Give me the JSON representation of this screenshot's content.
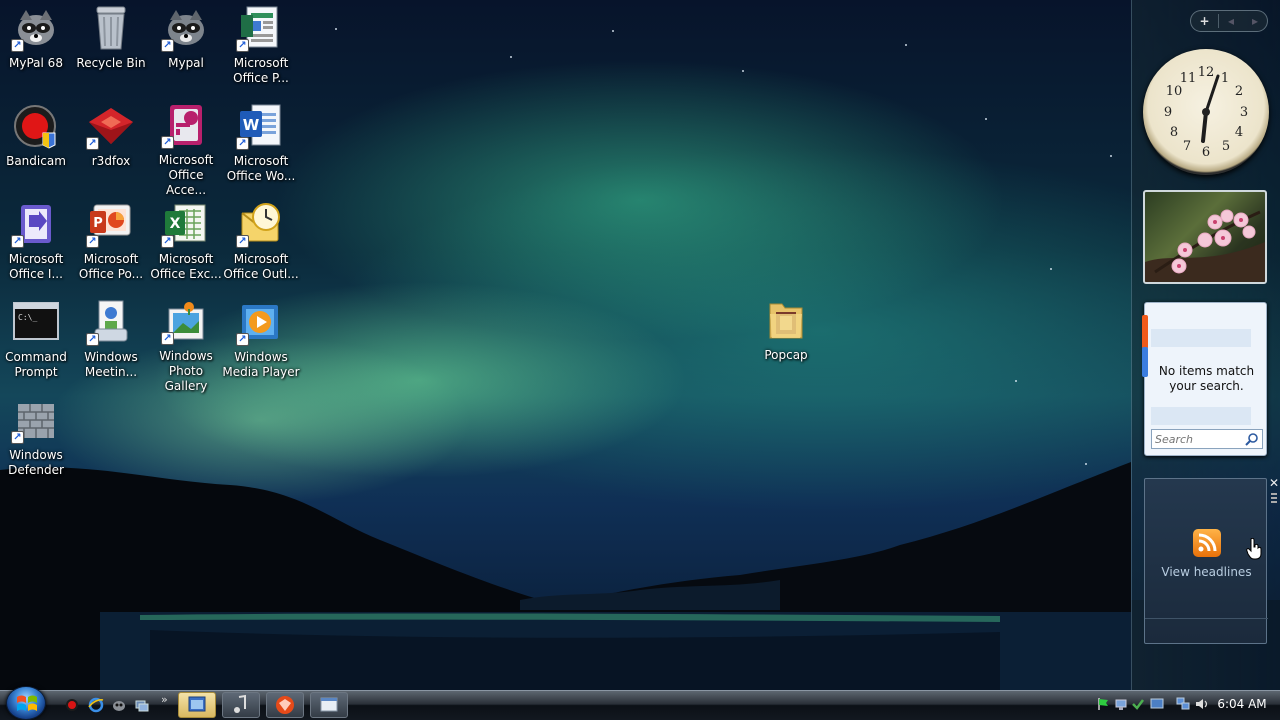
{
  "desktop": {
    "icons": [
      {
        "label": "MyPal 68"
      },
      {
        "label": "Recycle Bin"
      },
      {
        "label": "Mypal"
      },
      {
        "label": "Microsoft Office P..."
      },
      {
        "label": "Bandicam"
      },
      {
        "label": "r3dfox"
      },
      {
        "label": "Microsoft Office Acce..."
      },
      {
        "label": "Microsoft Office Wo..."
      },
      {
        "label": "Microsoft Office I..."
      },
      {
        "label": "Microsoft Office Po..."
      },
      {
        "label": "Microsoft Office Exc..."
      },
      {
        "label": "Microsoft Office Outl..."
      },
      {
        "label": "Command Prompt"
      },
      {
        "label": "Windows Meetin..."
      },
      {
        "label": "Windows Photo Gallery"
      },
      {
        "label": "Windows Media Player"
      },
      {
        "label": "Windows Defender"
      },
      {
        "label": "Popcap"
      }
    ]
  },
  "sidebar": {
    "add_label": "+",
    "prev_label": "◂",
    "next_label": "▸",
    "clock": {
      "time": "6:04"
    },
    "feed_search": {
      "message": "No items match your search.",
      "search_placeholder": "Search"
    },
    "headlines": {
      "link_label": "View headlines",
      "close_label": "✕"
    }
  },
  "taskbar": {
    "time": "6:04 AM"
  },
  "colors": {
    "rss_orange": "#e8710a",
    "taskbar_dark": "#121820",
    "aurora_green": "#78eba0"
  }
}
